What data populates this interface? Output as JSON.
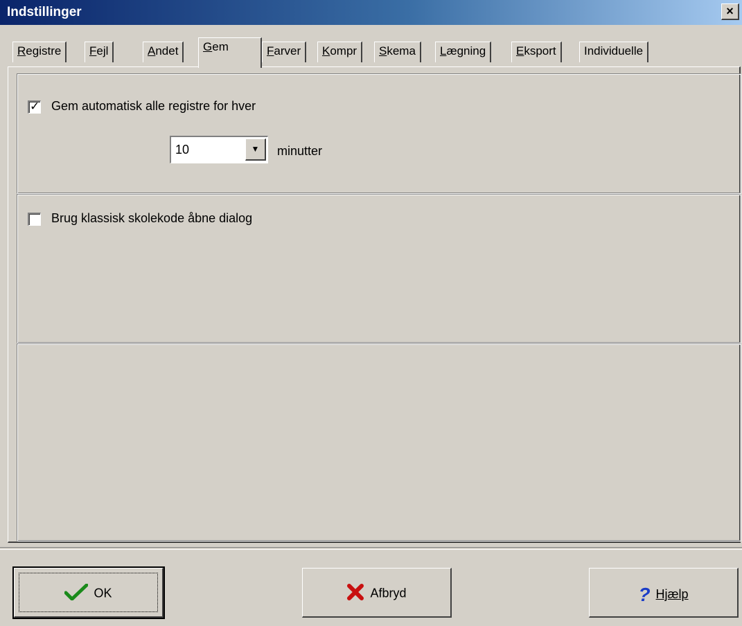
{
  "window": {
    "title": "Indstillinger",
    "close_label": "×"
  },
  "tabs": [
    {
      "label": "Registre",
      "mnemonic_index": 0,
      "active": false
    },
    {
      "label": "Fejl",
      "mnemonic_index": 0,
      "active": false
    },
    {
      "label": "Andet",
      "mnemonic_index": 0,
      "active": false
    },
    {
      "label": "Gem",
      "mnemonic_index": 0,
      "active": true
    },
    {
      "label": "Farver",
      "mnemonic_index": 0,
      "active": false
    },
    {
      "label": "Kompr",
      "mnemonic_index": 0,
      "active": false
    },
    {
      "label": "Skema",
      "mnemonic_index": 0,
      "active": false
    },
    {
      "label": "Lægning",
      "mnemonic_index": 0,
      "active": false
    },
    {
      "label": "Eksport",
      "mnemonic_index": 0,
      "active": false
    },
    {
      "label": "Individuelle",
      "mnemonic_index": -1,
      "active": false
    }
  ],
  "autosave": {
    "checkbox_label": "Gem automatisk alle registre for hver",
    "checked": true,
    "interval_value": "10",
    "unit_label": "minutter"
  },
  "classic_dialog": {
    "checkbox_label": "Brug klassisk skolekode åbne dialog",
    "checked": false
  },
  "buttons": {
    "ok": "OK",
    "cancel": "Afbryd",
    "help": "Hjælp"
  },
  "colors": {
    "face": "#d4d0c8",
    "titlebar_start": "#0a246a",
    "titlebar_end": "#a6caf0"
  }
}
